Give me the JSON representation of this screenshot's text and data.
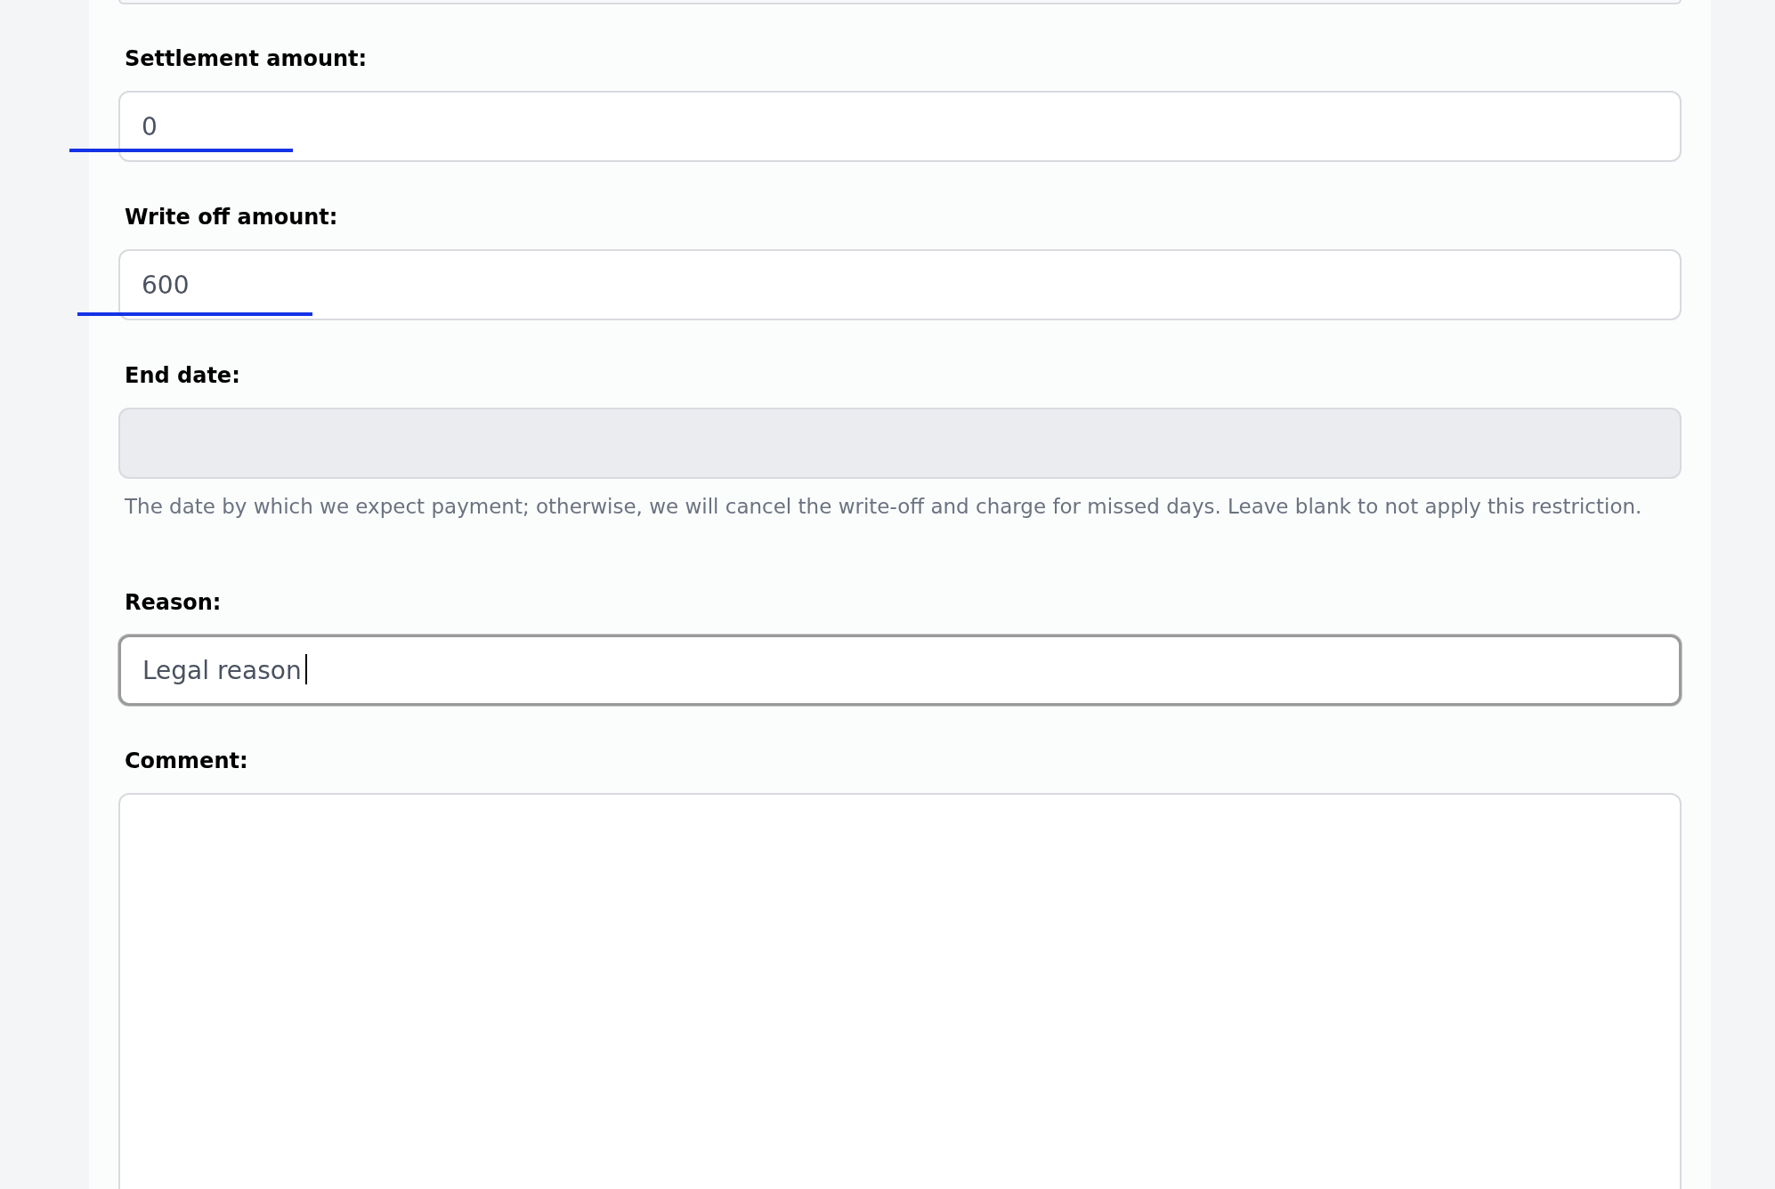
{
  "fields": [
    {
      "kind": "input",
      "label": "Settlement amount:",
      "value": "0",
      "disabled": false,
      "focused": false,
      "underlined": true
    },
    {
      "kind": "input",
      "label": "Write off amount:",
      "value": "600",
      "disabled": false,
      "focused": false,
      "underlined": true
    },
    {
      "kind": "input",
      "label": "End date:",
      "disabled": true,
      "focused": false,
      "underlined": false,
      "help": "The date by which we expect payment; otherwise, we will cancel the write-off and charge for missed days. Leave blank to not apply this restriction."
    },
    {
      "kind": "input",
      "label": "Reason:",
      "value": "Legal reason",
      "disabled": false,
      "focused": true,
      "underlined": false
    },
    {
      "kind": "textarea",
      "label": "Comment:",
      "disabled": false,
      "focused": false,
      "underlined": false
    }
  ]
}
